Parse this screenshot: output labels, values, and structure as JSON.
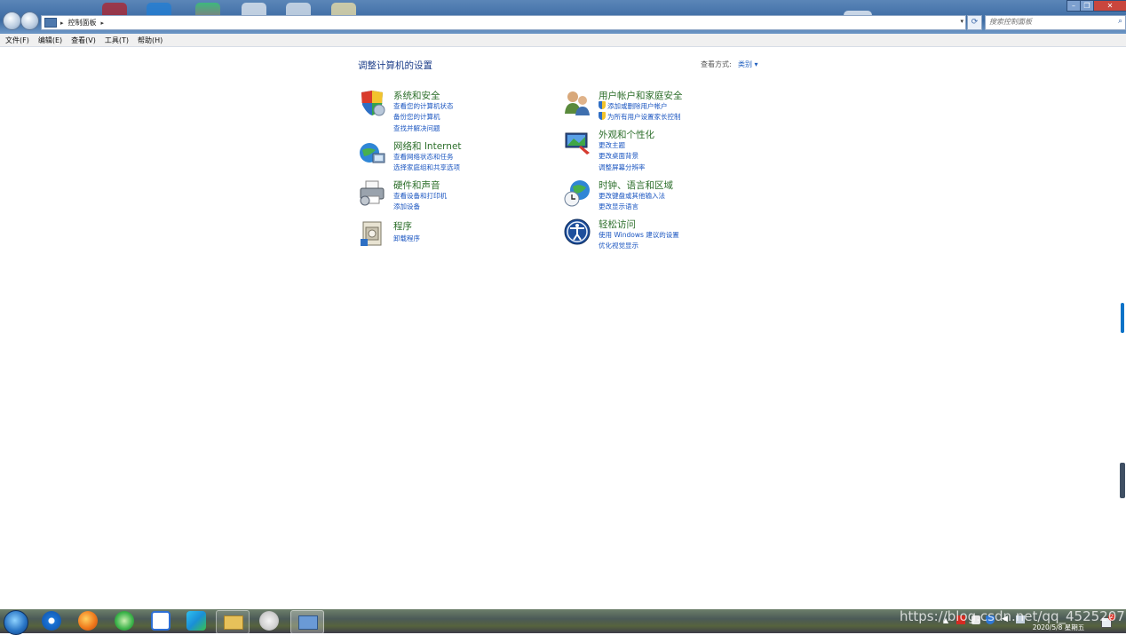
{
  "window": {
    "address_crumb": "控制面板",
    "search_placeholder": "搜索控制面板",
    "min_glyph": "–",
    "max_glyph": "❐",
    "close_glyph": "✕"
  },
  "menu": [
    "文件(F)",
    "编辑(E)",
    "查看(V)",
    "工具(T)",
    "帮助(H)"
  ],
  "content": {
    "heading": "调整计算机的设置",
    "view_by_label": "查看方式:",
    "view_by_value": "类别 ▾"
  },
  "categories": [
    {
      "title": "系统和安全",
      "links": [
        "查看您的计算机状态",
        "备份您的计算机",
        "查找并解决问题"
      ],
      "icon": "shield-icon"
    },
    {
      "title": "网络和 Internet",
      "links": [
        "查看网络状态和任务",
        "选择家庭组和共享选项"
      ],
      "icon": "network-icon"
    },
    {
      "title": "硬件和声音",
      "links": [
        "查看设备和打印机",
        "添加设备"
      ],
      "icon": "printer-icon"
    },
    {
      "title": "程序",
      "links": [
        "卸载程序"
      ],
      "icon": "programs-icon"
    },
    {
      "title": "用户帐户和家庭安全",
      "links": [
        "添加或删除用户帐户",
        "为所有用户设置家长控制"
      ],
      "icon": "users-icon"
    },
    {
      "title": "外观和个性化",
      "links": [
        "更改主题",
        "更改桌面背景",
        "调整屏幕分辨率"
      ],
      "icon": "appearance-icon"
    },
    {
      "title": "时钟、语言和区域",
      "links": [
        "更改键盘或其他输入法",
        "更改显示语言"
      ],
      "icon": "clock-globe-icon"
    },
    {
      "title": "轻松访问",
      "links": [
        "使用 Windows 建议的设置",
        "优化视觉显示"
      ],
      "icon": "accessibility-icon"
    }
  ],
  "taskbar": {
    "clock_date": "2020/5/8 星期五",
    "notification_count": "2",
    "watermark": "https://blog.csdn.net/qq_4525207"
  }
}
